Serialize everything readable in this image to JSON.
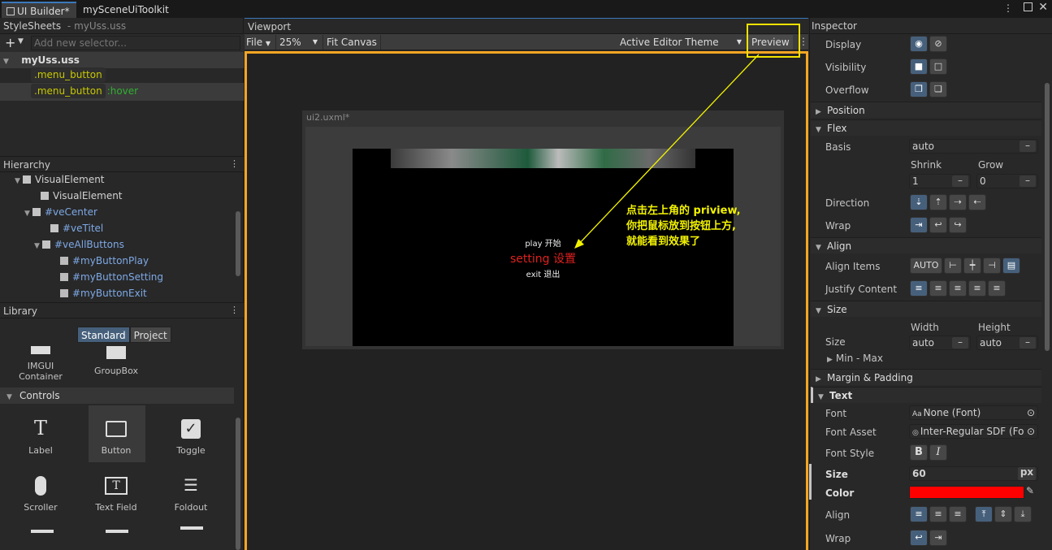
{
  "tabs": [
    "UI Builder*",
    "mySceneUiToolkit"
  ],
  "stylesheets": {
    "title": "StyleSheets",
    "file": "- myUss.uss",
    "add_placeholder": "Add new selector...",
    "sheet_name": "myUss.uss",
    "selectors": [
      ".menu_button",
      ".menu_button"
    ],
    "hover_suffix": ":hover"
  },
  "hierarchy": {
    "title": "Hierarchy",
    "items": [
      "VisualElement",
      "VisualElement",
      "#veCenter",
      "#veTitel",
      "#veAllButtons",
      "#myButtonPlay",
      "#myButtonSetting",
      "#myButtonExit"
    ]
  },
  "library": {
    "title": "Library",
    "tab_standard": "Standard",
    "tab_project": "Project",
    "top_items": [
      "IMGUI\nContainer",
      "GroupBox"
    ],
    "controls_title": "Controls",
    "controls": [
      "Label",
      "Button",
      "Toggle",
      "Scroller",
      "Text Field",
      "Foldout"
    ]
  },
  "viewport": {
    "title": "Viewport",
    "file_menu": "File",
    "zoom": "25%",
    "fit_canvas": "Fit Canvas",
    "theme": "Active Editor Theme",
    "preview": "Preview",
    "canvas_title": "ui2.uxml*",
    "button_play": "play 开始",
    "button_setting": "setting 设置",
    "button_exit": "exit 退出",
    "annotation": [
      "点击左上角的 priview,",
      "你把鼠标放到按钮上方,",
      "就能看到效果了"
    ]
  },
  "inspector": {
    "title": "Inspector",
    "display_label": "Display",
    "visibility_label": "Visibility",
    "overflow_label": "Overflow",
    "position_section": "Position",
    "flex_section": "Flex",
    "basis_label": "Basis",
    "basis_value": "auto",
    "shrink_label": "Shrink",
    "grow_label": "Grow",
    "shrink_value": "1",
    "grow_value": "0",
    "direction_label": "Direction",
    "wrap_label": "Wrap",
    "align_section": "Align",
    "align_items_label": "Align Items",
    "align_auto": "AUTO",
    "justify_label": "Justify Content",
    "size_section": "Size",
    "width_label": "Width",
    "height_label": "Height",
    "size_label": "Size",
    "width_value": "auto",
    "height_value": "auto",
    "minmax_label": "Min - Max",
    "margin_section": "Margin & Padding",
    "text_section": "Text",
    "font_label": "Font",
    "font_value": "None (Font)",
    "font_asset_label": "Font Asset",
    "font_asset_value": "Inter-Regular SDF (Fo",
    "font_style_label": "Font Style",
    "text_size_label": "Size",
    "text_size_value": "60",
    "px_unit": "px",
    "color_label": "Color",
    "color_value": "#ff0000",
    "text_align_label": "Align",
    "text_wrap_label": "Wrap"
  },
  "colors": {
    "accent_orange": "#f5a623",
    "annotation_yellow": "#f2f200",
    "setting_red": "#e02020"
  }
}
